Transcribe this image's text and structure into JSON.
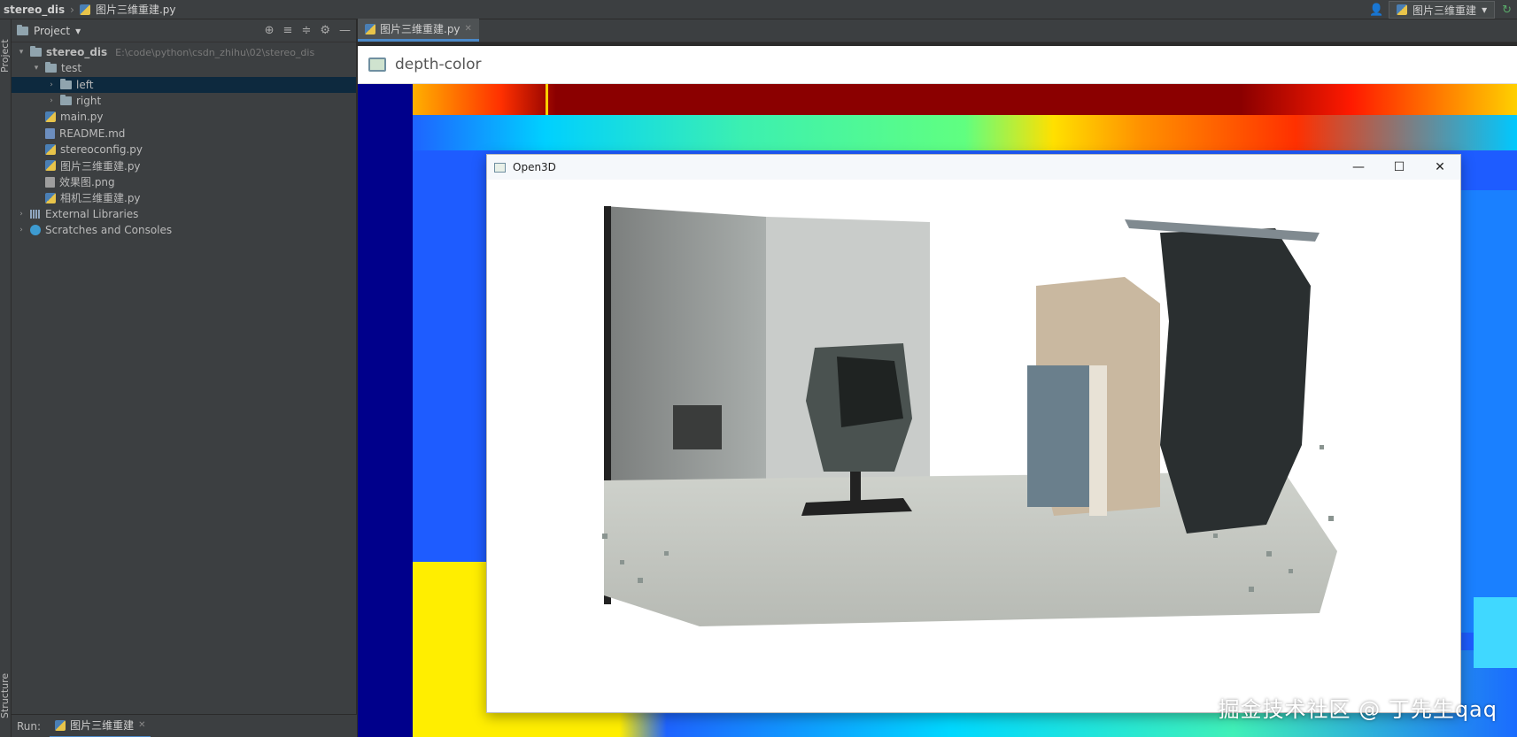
{
  "topbar": {
    "project": "stereo_dis",
    "file": "图片三维重建.py",
    "run_config": "图片三维重建"
  },
  "stripe": {
    "project_label": "Project",
    "structure_label": "Structure"
  },
  "project_panel": {
    "title": "Project",
    "tree": [
      {
        "label": "stereo_dis",
        "path": "E:\\code\\python\\csdn_zhihu\\02\\stereo_dis",
        "depth": 0,
        "kind": "folder",
        "expanded": true
      },
      {
        "label": "test",
        "depth": 1,
        "kind": "folder",
        "expanded": true
      },
      {
        "label": "left",
        "depth": 2,
        "kind": "folder",
        "expanded": false,
        "selected": true
      },
      {
        "label": "right",
        "depth": 2,
        "kind": "folder",
        "expanded": false
      },
      {
        "label": "main.py",
        "depth": 1,
        "kind": "py"
      },
      {
        "label": "README.md",
        "depth": 1,
        "kind": "md"
      },
      {
        "label": "stereoconfig.py",
        "depth": 1,
        "kind": "py"
      },
      {
        "label": "图片三维重建.py",
        "depth": 1,
        "kind": "py"
      },
      {
        "label": "效果图.png",
        "depth": 1,
        "kind": "png"
      },
      {
        "label": "相机三维重建.py",
        "depth": 1,
        "kind": "py"
      },
      {
        "label": "External Libraries",
        "depth": 0,
        "kind": "lib",
        "expanded": false
      },
      {
        "label": "Scratches and Consoles",
        "depth": 0,
        "kind": "scratch",
        "expanded": false
      }
    ]
  },
  "editor": {
    "tab_label": "图片三维重建.py"
  },
  "depth_window": {
    "title": "depth-color"
  },
  "open3d_window": {
    "title": "Open3D"
  },
  "runbar": {
    "label": "Run:",
    "tab_label": "图片三维重建"
  },
  "watermark": "掘金技术社区 @ 丁先生qaq",
  "colors": {
    "ide_bg": "#2b2b2b",
    "panel_bg": "#3c3f41",
    "selection": "#0d293e",
    "accent": "#4a88c7"
  }
}
